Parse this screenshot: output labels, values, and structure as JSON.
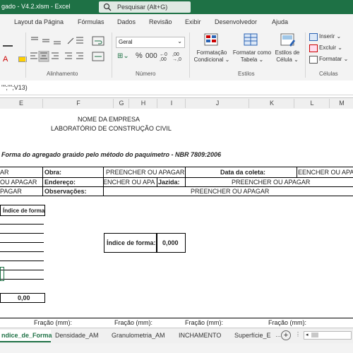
{
  "title_bar": {
    "title": "gado - V4.2.xlsm  -  Excel",
    "search_placeholder": "Pesquisar (Alt+G)"
  },
  "menu": [
    "Layout da Página",
    "Fórmulas",
    "Dados",
    "Revisão",
    "Exibir",
    "Desenvolvedor",
    "Ajuda"
  ],
  "ribbon": {
    "number_format": "Geral",
    "groups": {
      "alinhamento": "Alinhamento",
      "numero": "Número",
      "estilos": "Estilos",
      "celulas": "Células"
    },
    "formatacao_condicional": [
      "Formatação",
      "Condicional"
    ],
    "formatar_tabela": [
      "Formatar como",
      "Tabela"
    ],
    "estilos_celula": [
      "Estilos de",
      "Célula"
    ],
    "inserir": "Inserir",
    "excluir": "Excluir",
    "formatar": "Formatar"
  },
  "formula_bar": {
    "text": "\"\";\"\";V13)"
  },
  "columns": [
    "E",
    "F",
    "G",
    "H",
    "I",
    "J",
    "K",
    "L",
    "M"
  ],
  "sheet": {
    "company": "NOME DA EMPRESA",
    "lab": "LABORATÓRIO DE CONSTRUÇÃO CIVIL",
    "form_title": "Forma do agregado graúdo pelo método do paquímetro - NBR 7809:2006",
    "obra_label": "Obra:",
    "endereco_label": "Endereço:",
    "observacoes_label": "Observações:",
    "data_coleta_label": "Data da coleta:",
    "jazida_label": "Jazida:",
    "left_r1": "AR",
    "left_r2": "OU APAGAR",
    "left_r3": "PAGAR",
    "fill_obra": "PREENCHER OU APAGAR",
    "fill_endereco": "ENCHER OU APA",
    "fill_jazida": "PREENCHER OU APAGAR",
    "fill_observacoes": "PREENCHER OU APAGAR",
    "fill_data": "EENCHER OU APA",
    "indice_header": "Índice de forma",
    "indice_label": "Índice de forma:",
    "indice_value": "0,000",
    "total_value": "0,00",
    "fracao": "Fração (mm):"
  },
  "tabs": [
    "ndice_de_Forma",
    "Densidade_AM",
    "Granulometria_AM",
    "INCHAMENTO",
    "Superfície_E"
  ],
  "colors": {
    "excel_green": "#1e7145",
    "ribbon_bg": "#f3f3f3"
  }
}
